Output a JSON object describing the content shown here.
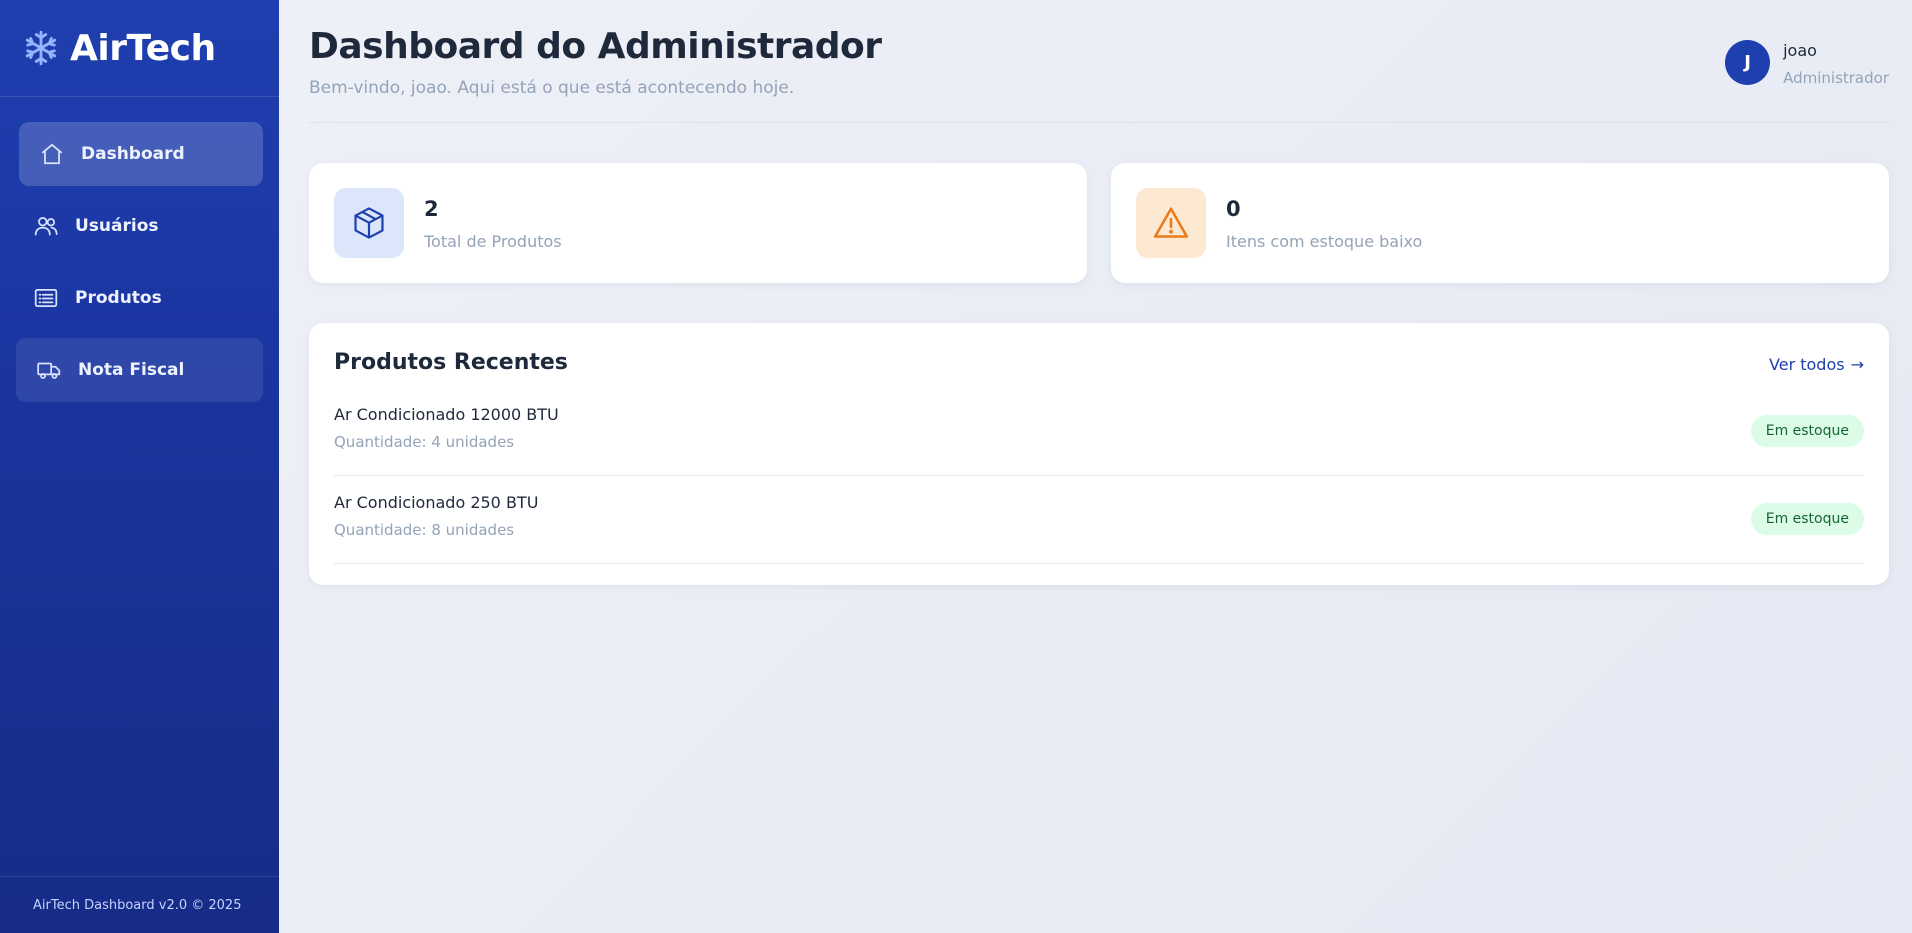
{
  "sidebar": {
    "brand": "AirTech",
    "items": [
      {
        "label": "Dashboard",
        "icon": "home-icon"
      },
      {
        "label": "Usuários",
        "icon": "users-icon"
      },
      {
        "label": "Produtos",
        "icon": "list-icon"
      },
      {
        "label": "Nota Fiscal",
        "icon": "truck-icon"
      }
    ],
    "footer": "AirTech Dashboard v2.0 © 2025"
  },
  "header": {
    "title": "Dashboard do Administrador",
    "subtitle": "Bem-vindo, joao. Aqui está o que está acontecendo hoje.",
    "user": {
      "initial": "J",
      "name": "joao",
      "role": "Administrador"
    }
  },
  "stats": [
    {
      "value": "2",
      "label": "Total de Produtos",
      "icon": "box-icon"
    },
    {
      "value": "0",
      "label": "Itens com estoque baixo",
      "icon": "warning-icon"
    }
  ],
  "recent": {
    "title": "Produtos Recentes",
    "see_all": "Ver todos",
    "items": [
      {
        "name": "Ar Condicionado 12000 BTU",
        "quantity": "Quantidade: 4 unidades",
        "status": "Em estoque"
      },
      {
        "name": "Ar Condicionado 250 BTU",
        "quantity": "Quantidade: 8 unidades",
        "status": "Em estoque"
      }
    ]
  },
  "colors": {
    "sidebar": "#1f3fb0",
    "accent": "#1e40af",
    "badge_bg": "#dcfce7",
    "badge_text": "#166534",
    "warning": "#ea7a1a"
  }
}
